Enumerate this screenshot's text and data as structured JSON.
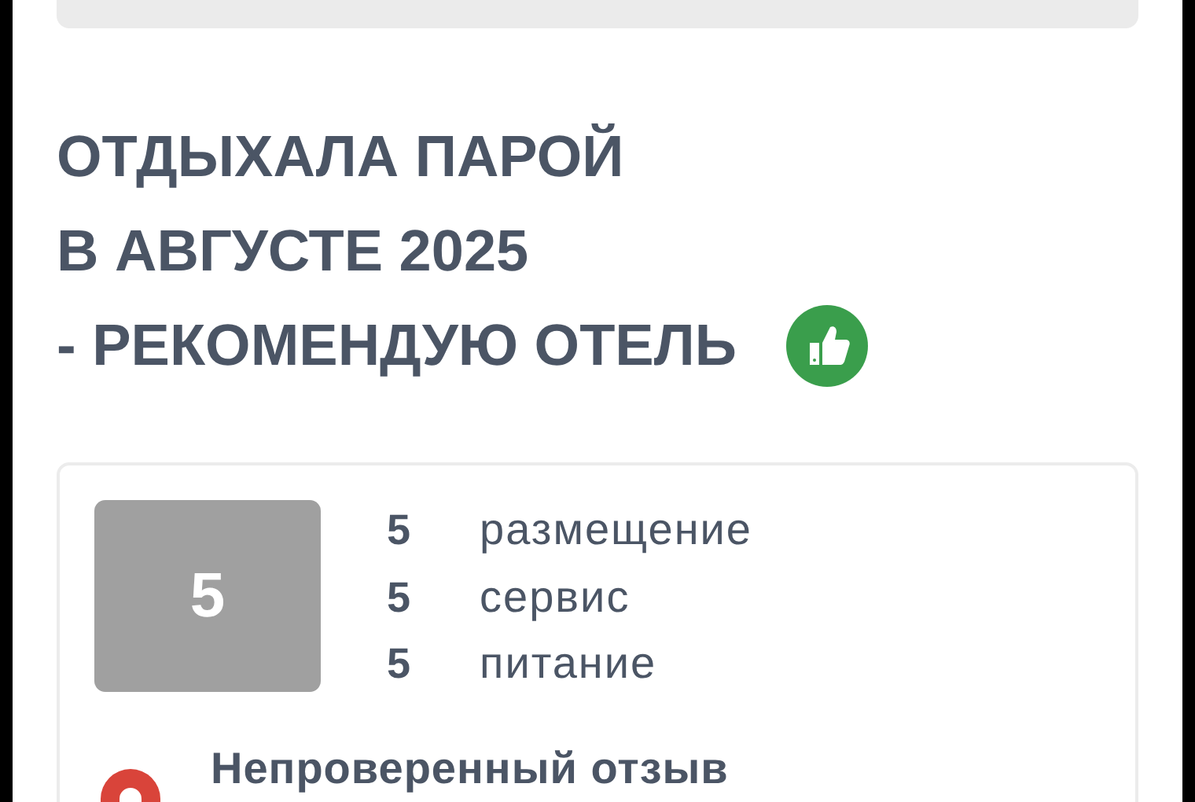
{
  "review": {
    "title_lines": [
      "ОТДЫХАЛА ПАРОЙ",
      "В АВГУСТЕ 2025",
      "- РЕКОМЕНДУЮ ОТЕЛЬ"
    ],
    "recommended": true,
    "overall_score": "5",
    "ratings": [
      {
        "score": "5",
        "label": "размещение"
      },
      {
        "score": "5",
        "label": "сервис"
      },
      {
        "score": "5",
        "label": "питание"
      }
    ],
    "status": "Непроверенный отзыв"
  }
}
